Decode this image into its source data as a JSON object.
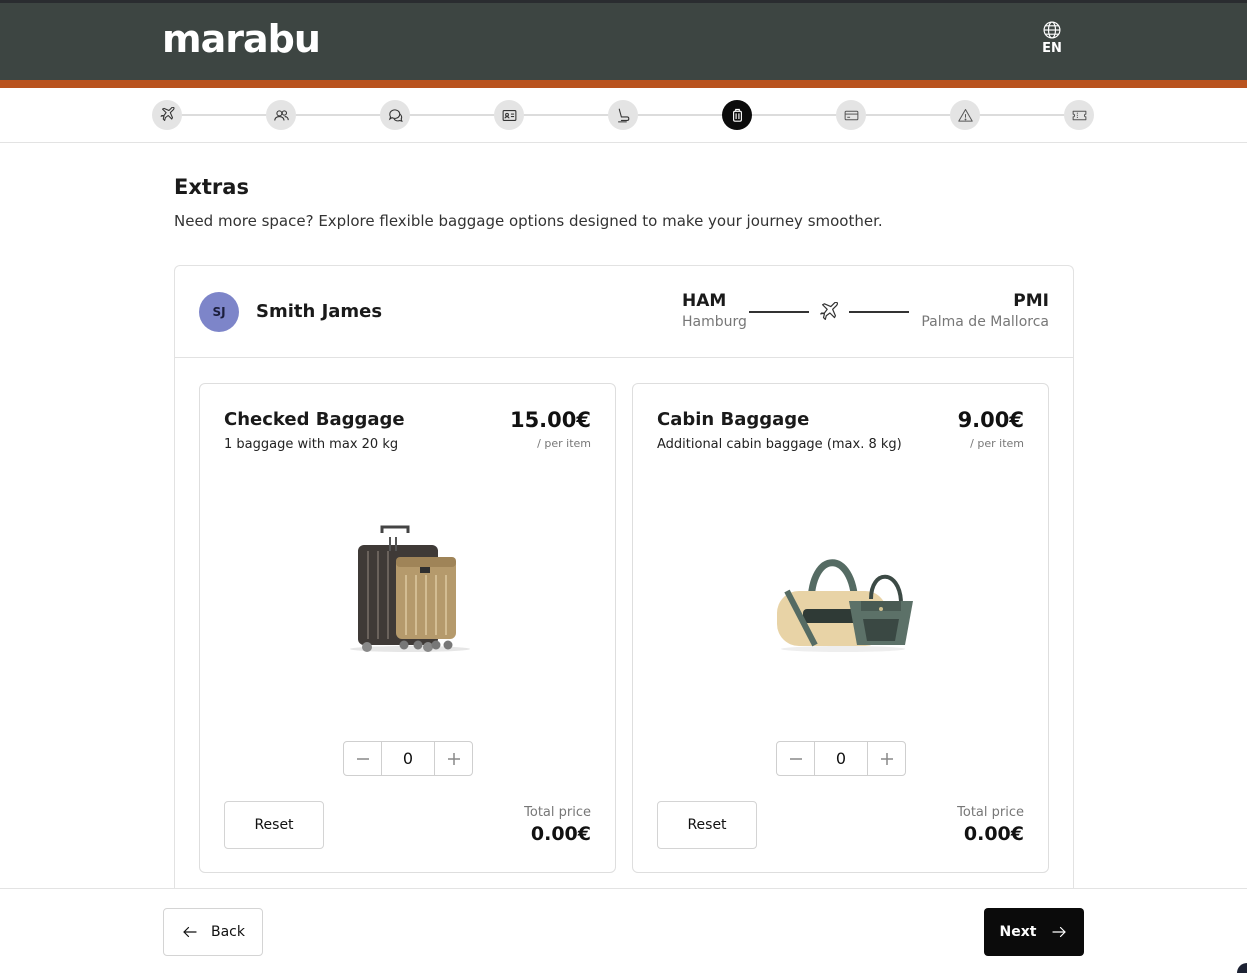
{
  "header": {
    "logo_text": "marabu",
    "language": {
      "icon": "globe-icon",
      "label": "EN"
    },
    "colors": {
      "background": "#3d4542",
      "accent": "#b9531f"
    }
  },
  "stepper": {
    "steps": [
      {
        "icon": "flight-icon",
        "active": false
      },
      {
        "icon": "passengers-icon",
        "active": false
      },
      {
        "icon": "chat-icon",
        "active": false
      },
      {
        "icon": "id-card-icon",
        "active": false
      },
      {
        "icon": "seat-icon",
        "active": false
      },
      {
        "icon": "luggage-icon",
        "active": true
      },
      {
        "icon": "payment-card-icon",
        "active": false
      },
      {
        "icon": "warning-icon",
        "active": false
      },
      {
        "icon": "ticket-icon",
        "active": false
      }
    ]
  },
  "page": {
    "title": "Extras",
    "subtitle": "Need more space? Explore flexible baggage options designed to make your journey smoother."
  },
  "passenger": {
    "initials": "SJ",
    "name": "Smith James",
    "avatar_color": "#7d85c9"
  },
  "route": {
    "from_code": "HAM",
    "from_city": "Hamburg",
    "to_code": "PMI",
    "to_city": "Palma de Mallorca"
  },
  "cards": [
    {
      "title": "Checked Baggage",
      "description": "1 baggage with max 20 kg",
      "price": "15.00€",
      "per_item": "/ per item",
      "image": "suitcases-image",
      "quantity": "0",
      "reset_label": "Reset",
      "total_label": "Total price",
      "total_value": "0.00€"
    },
    {
      "title": "Cabin Baggage",
      "description": "Additional cabin baggage (max. 8 kg)",
      "price": "9.00€",
      "per_item": "/ per item",
      "image": "duffel-bag-image",
      "quantity": "0",
      "reset_label": "Reset",
      "total_label": "Total price",
      "total_value": "0.00€"
    }
  ],
  "footer": {
    "back_label": "Back",
    "next_label": "Next"
  }
}
